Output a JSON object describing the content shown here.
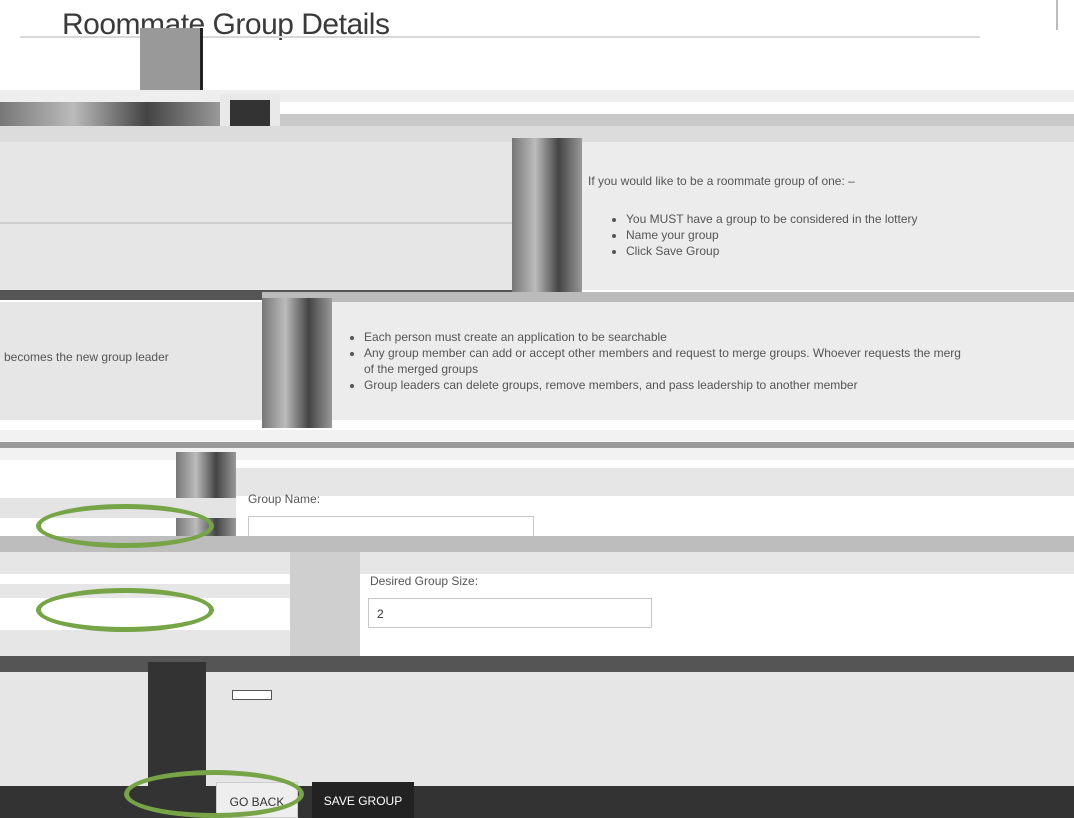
{
  "page": {
    "title": "Roommate Group Details",
    "left_note": "becomes the new group leader"
  },
  "group_of_one": {
    "intro": "If you would like to be a roommate group of one: –",
    "bullets": [
      "You MUST have a group to be considered in the lottery",
      "Name your group",
      "Click Save Group"
    ]
  },
  "multi_group": {
    "bullets": [
      "Each person must create an application to be searchable",
      "Any group member can add or accept other members and request to merge groups. Whoever requests the merg",
      "of the merged groups",
      "Group leaders can delete groups, remove members, and pass leadership to another member"
    ]
  },
  "form": {
    "group_name_label": "Group Name:",
    "desired_size_label": "Desired Group Size:",
    "desired_size_value": "2"
  },
  "buttons": {
    "go_back": "GO BACK",
    "save_group": "SAVE GROUP"
  },
  "colors": {
    "highlight_ellipse": "#76a447",
    "save_button": "#222222"
  }
}
